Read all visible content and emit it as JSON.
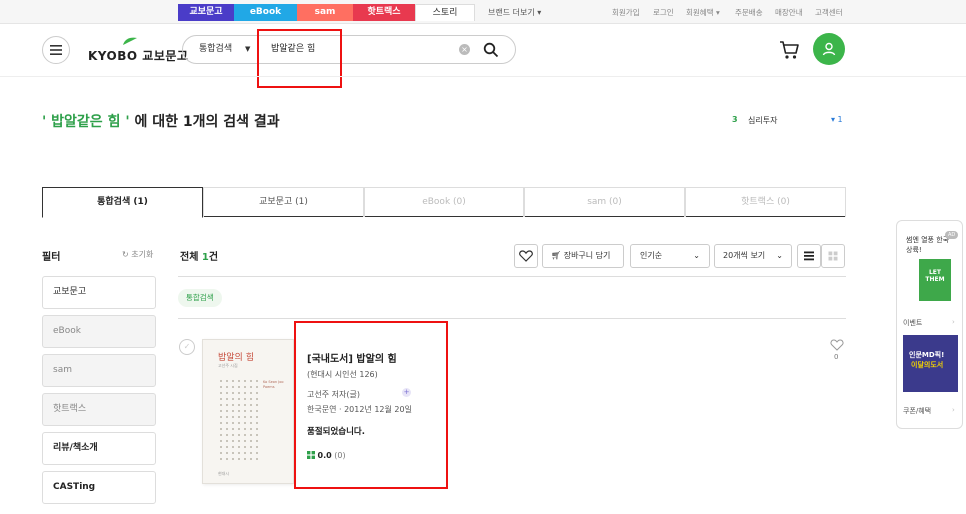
{
  "brand_tabs": [
    "교보문고",
    "eBook",
    "sam",
    "핫트랙스",
    "스토리"
  ],
  "brand_more": "브랜드 더보기 ▾",
  "util_links": [
    "회원가입",
    "로그인",
    "회원혜택 ▾",
    "주문배송",
    "매장안내",
    "고객센터"
  ],
  "logo": {
    "text": "KYOBO 교보문고"
  },
  "search": {
    "category": "통합검색",
    "query": "밥알같은 힘"
  },
  "result": {
    "quote_open": "' ",
    "query": "밥알같은 힘",
    "quote_close": " '",
    "suffix": " 에 대한 1개의 검색 결과"
  },
  "ranking": {
    "rank": "3",
    "keyword": "심리투자",
    "change": "▾ 1"
  },
  "tabs": [
    "통합검색 (1)",
    "교보문고 (1)",
    "eBook (0)",
    "sam (0)",
    "핫트랙스 (0)"
  ],
  "filter": {
    "title": "필터",
    "reset": "초기화",
    "items": [
      "교보문고",
      "eBook",
      "sam",
      "핫트랙스",
      "리뷰/책소개",
      "CASTing"
    ]
  },
  "list": {
    "total_label": "전체 ",
    "total_count": "1",
    "total_unit": "건",
    "cart_button": "장바구니 담기",
    "sort": "인기순",
    "page_size": "20개씩 보기",
    "chip": "통합검색"
  },
  "book": {
    "title": "[국내도서] 밥알의 힘",
    "series": "(현대시 시인선 126)",
    "author": "고선주 저자(글)",
    "publisher_date": "한국문연 · 2012년 12월 20일",
    "status": "품절되었습니다.",
    "rating": "0.0",
    "review_count": "(0)",
    "like_count": "0",
    "cover_title": "밥알의 힘",
    "cover_author": "고선주 시집",
    "cover_side": "Ko Seon Joo Poems",
    "cover_pub": "현대시"
  },
  "side_panel": {
    "headline": "썸엔 열풍 한국 상륙!",
    "ad": "AD",
    "book1_text": "LET THEM",
    "event": "이벤트",
    "book2_line1": "인문MD픽!",
    "book2_line2": "이달의도서",
    "coupon": "쿠폰/혜택"
  },
  "colors": {
    "accent_green": "#2ea04a",
    "highlight_red": "#e11111"
  }
}
